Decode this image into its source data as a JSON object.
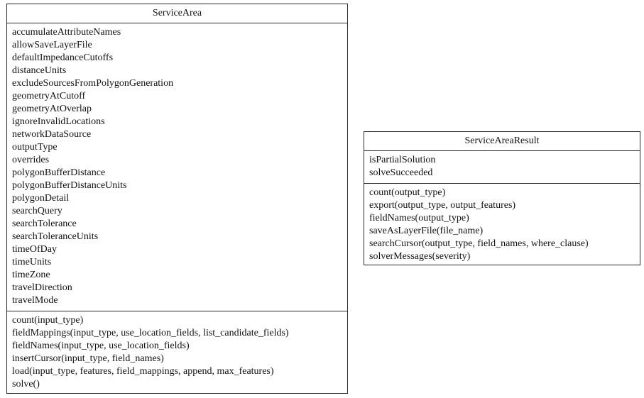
{
  "diagram": {
    "type": "uml-class-diagram",
    "classes": [
      {
        "name": "ServiceArea",
        "attributes": [
          "accumulateAttributeNames",
          "allowSaveLayerFile",
          "defaultImpedanceCutoffs",
          "distanceUnits",
          "excludeSourcesFromPolygonGeneration",
          "geometryAtCutoff",
          "geometryAtOverlap",
          "ignoreInvalidLocations",
          "networkDataSource",
          "outputType",
          "overrides",
          "polygonBufferDistance",
          "polygonBufferDistanceUnits",
          "polygonDetail",
          "searchQuery",
          "searchTolerance",
          "searchToleranceUnits",
          "timeOfDay",
          "timeUnits",
          "timeZone",
          "travelDirection",
          "travelMode"
        ],
        "methods": [
          "count(input_type)",
          "fieldMappings(input_type, use_location_fields, list_candidate_fields)",
          "fieldNames(input_type, use_location_fields)",
          "insertCursor(input_type, field_names)",
          "load(input_type, features, field_mappings, append, max_features)",
          "solve()"
        ]
      },
      {
        "name": "ServiceAreaResult",
        "attributes": [
          "isPartialSolution",
          "solveSucceeded"
        ],
        "methods": [
          "count(output_type)",
          "export(output_type, output_features)",
          "fieldNames(output_type)",
          "saveAsLayerFile(file_name)",
          "searchCursor(output_type, field_names, where_clause)",
          "solverMessages(severity)"
        ]
      }
    ]
  },
  "colors": {
    "background": "#ffffff",
    "border": "#2b2b2b",
    "text": "#111111"
  }
}
